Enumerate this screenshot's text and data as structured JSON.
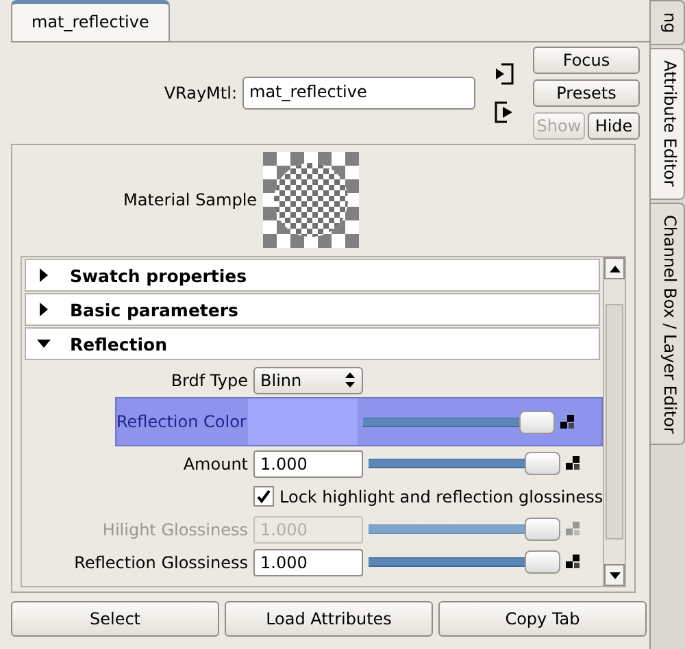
{
  "tabs": [
    {
      "label": "mat_reflective",
      "selected": true
    }
  ],
  "side_tabs": [
    {
      "label": "ng",
      "selected": false
    },
    {
      "label": "Attribute Editor",
      "selected": true
    },
    {
      "label": "Channel Box / Layer Editor",
      "selected": false
    }
  ],
  "node": {
    "label": "VRayMtl:",
    "value": "mat_reflective"
  },
  "buttons": [
    {
      "label": "Focus",
      "disabled": false
    },
    {
      "label": "Presets",
      "disabled": false
    },
    {
      "label": "Show",
      "disabled": true
    },
    {
      "label": "Hide",
      "disabled": false
    }
  ],
  "material_sample": {
    "label": "Material Sample"
  },
  "sections": [
    {
      "title": "Swatch properties",
      "expanded": false
    },
    {
      "title": "Basic parameters",
      "expanded": false
    },
    {
      "title": "Reflection",
      "expanded": true
    }
  ],
  "attributes": [
    {
      "kind": "dropdown",
      "label": "Brdf Type",
      "value": "Blinn",
      "selected": false,
      "disabled": false
    },
    {
      "kind": "color",
      "label": "Reflection Color",
      "color": "#a1a6fa",
      "level": 1,
      "selected": true,
      "disabled": false
    },
    {
      "kind": "slider",
      "label": "Amount",
      "value": "1.000",
      "level": 1,
      "selected": false,
      "disabled": false
    },
    {
      "kind": "checkbox",
      "label": "Lock highlight and reflection glossiness",
      "checked": true,
      "selected": false,
      "disabled": false
    },
    {
      "kind": "slider",
      "label": "Hilight Glossiness",
      "value": "1.000",
      "level": 1,
      "selected": false,
      "disabled": true
    },
    {
      "kind": "slider",
      "label": "Reflection Glossiness",
      "value": "1.000",
      "level": 1,
      "selected": false,
      "disabled": false
    }
  ],
  "bottom_buttons": [
    "Select",
    "Load Attributes",
    "Copy Tab"
  ]
}
